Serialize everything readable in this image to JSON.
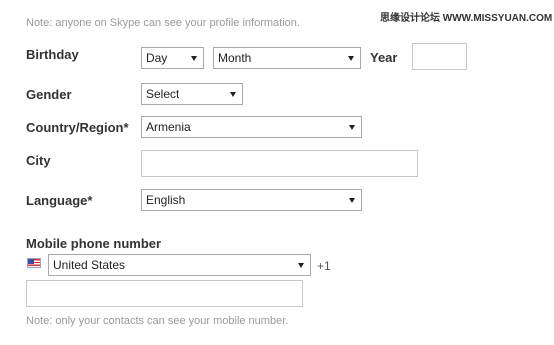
{
  "watermark": "思缘设计论坛  WWW.MISSYUAN.COM",
  "profile_note": "Note: anyone on Skype can see your profile information.",
  "birthday": {
    "label": "Birthday",
    "day": "Day",
    "month": "Month",
    "year_label": "Year",
    "year_value": ""
  },
  "gender": {
    "label": "Gender",
    "value": "Select"
  },
  "country": {
    "label": "Country/Region*",
    "value": "Armenia"
  },
  "city": {
    "label": "City",
    "value": ""
  },
  "language": {
    "label": "Language*",
    "value": "English"
  },
  "mobile": {
    "label": "Mobile phone number",
    "country": "United States",
    "flag_icon": "us-flag-icon",
    "code": "+1",
    "number": ""
  },
  "mobile_note": "Note: only your contacts can see your mobile number."
}
